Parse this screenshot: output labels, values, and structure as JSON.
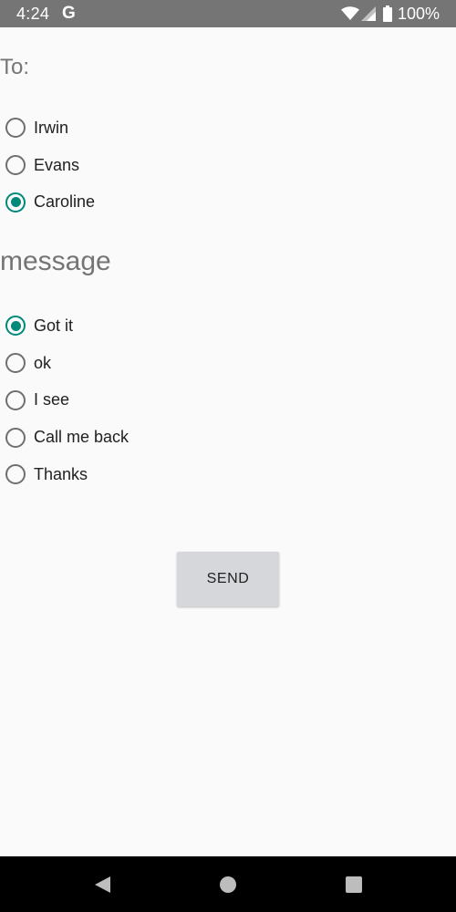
{
  "status_bar": {
    "time": "4:24",
    "app_indicator": "G",
    "battery": "100%",
    "icons": [
      "wifi-icon",
      "signal-icon",
      "battery-icon"
    ]
  },
  "recipients": {
    "label": "To:",
    "options": [
      {
        "label": "Irwin",
        "checked": false
      },
      {
        "label": "Evans",
        "checked": false
      },
      {
        "label": "Caroline",
        "checked": true
      }
    ]
  },
  "message": {
    "label": "message",
    "options": [
      {
        "label": "Got it",
        "checked": true
      },
      {
        "label": "ok",
        "checked": false
      },
      {
        "label": "I see",
        "checked": false
      },
      {
        "label": "Call me back",
        "checked": false
      },
      {
        "label": "Thanks",
        "checked": false
      }
    ]
  },
  "send_button": {
    "label": "SEND"
  },
  "nav_bar": {
    "icons": [
      "back-icon",
      "home-icon",
      "recents-icon"
    ]
  },
  "colors": {
    "accent": "#00897b",
    "status_bar": "#757575",
    "background": "#fafafa",
    "button": "#d6d7db"
  }
}
